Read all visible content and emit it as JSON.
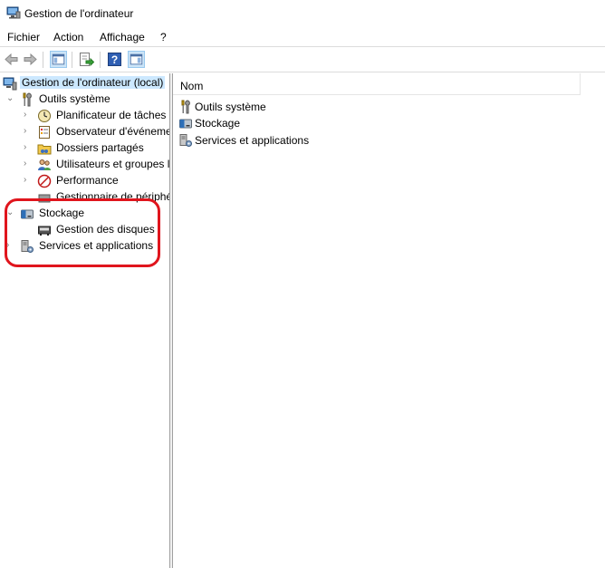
{
  "window": {
    "title": "Gestion de l'ordinateur"
  },
  "menu": {
    "items": [
      "Fichier",
      "Action",
      "Affichage",
      "?"
    ]
  },
  "toolbar": {
    "buttons": [
      "back-arrow-icon",
      "forward-arrow-icon",
      "show-hide-console-tree-icon",
      "export-list-icon",
      "help-icon",
      "action-pane-icon"
    ]
  },
  "tree": {
    "root": "Gestion de l'ordinateur (local)",
    "outils": "Outils système",
    "planificateur": "Planificateur de tâches",
    "observateur": "Observateur d'événeme",
    "dossiers": "Dossiers partagés",
    "utilisateurs": "Utilisateurs et groupes l",
    "performance": "Performance",
    "gestionnaire": "Gestionnaire de périphé",
    "stockage": "Stockage",
    "gestion_disques": "Gestion des disques",
    "services": "Services et applications"
  },
  "list": {
    "column": "Nom",
    "items": [
      "Outils système",
      "Stockage",
      "Services et applications"
    ]
  },
  "colors": {
    "selection": "#cce8ff",
    "highlight": "#e0151d"
  }
}
